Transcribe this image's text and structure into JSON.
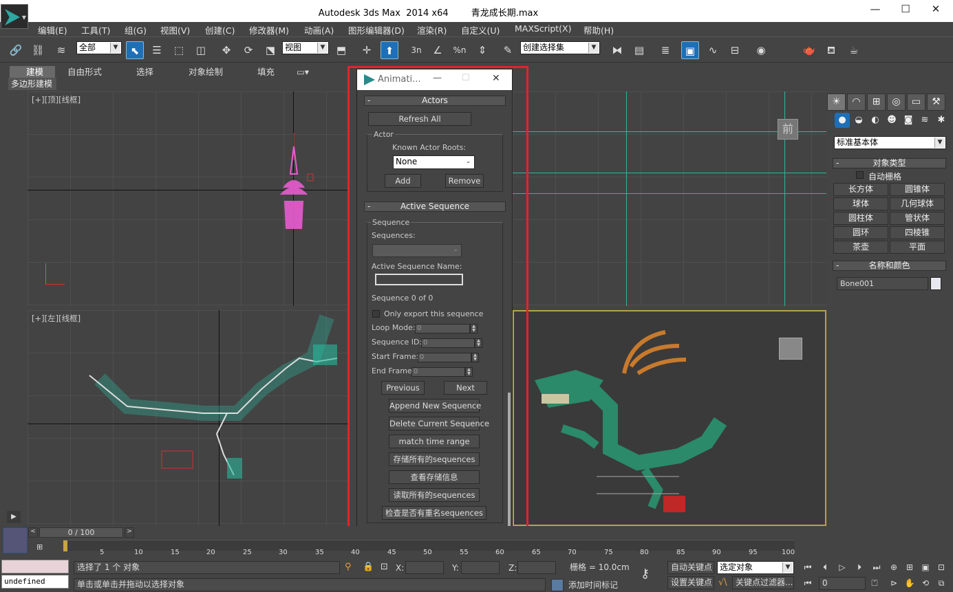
{
  "window": {
    "app_title": "Autodesk 3ds Max  2014 x64",
    "file_title": "青龙成长期.max",
    "minimize": "—",
    "maximize": "☐",
    "close": "✕"
  },
  "menu": [
    "编辑(E)",
    "工具(T)",
    "组(G)",
    "视图(V)",
    "创建(C)",
    "修改器(M)",
    "动画(A)",
    "图形编辑器(D)",
    "渲染(R)",
    "自定义(U)",
    "MAXScript(X)",
    "帮助(H)"
  ],
  "toolbar": {
    "selection_filter": "全部",
    "ref_coord": "视图",
    "named_selection": "创建选择集",
    "snap_label": "3n",
    "angle_snap": "%n"
  },
  "ribbon": {
    "tabs": [
      "建模",
      "自由形式",
      "选择",
      "对象绘制",
      "填充"
    ],
    "active_panel": "多边形建模"
  },
  "viewports": {
    "top_label": "[+][顶][线框]",
    "left_label": "[+][左][线框]",
    "persp_cube_label": "前"
  },
  "command_panel": {
    "tabs": [
      "☀",
      "◠",
      "⊞",
      "◎",
      "▭",
      "⚒"
    ],
    "subtabs": [
      "●",
      "◒",
      "◐",
      "☻",
      "◙",
      "≋",
      "✱"
    ],
    "category": "标准基本体",
    "object_type_title": "对象类型",
    "autogrid": "自动栅格",
    "buttons": [
      "长方体",
      "圆锥体",
      "球体",
      "几何球体",
      "圆柱体",
      "管状体",
      "圆环",
      "四棱锥",
      "茶壶",
      "平面"
    ],
    "name_color_title": "名称和颜色",
    "object_name": "Bone001",
    "object_color": "#e8e8f0"
  },
  "dialog": {
    "title": "Animati...",
    "actors_title": "Actors",
    "refresh_all": "Refresh All",
    "actor_group": "Actor",
    "known_roots_label": "Known Actor Roots:",
    "known_roots_value": "None",
    "add": "Add",
    "remove": "Remove",
    "active_seq_title": "Active Sequence",
    "sequence_group": "Sequence",
    "sequences_label": "Sequences:",
    "active_seq_name_label": "Active Sequence Name:",
    "seq_count": "Sequence 0 of 0",
    "only_export": "Only export this sequence",
    "loop_mode_label": "Loop Mode:",
    "loop_mode": "0",
    "seq_id_label": "Sequence ID:",
    "seq_id": "0",
    "start_frame_label": "Start Frame:",
    "start_frame": "0",
    "end_frame_label": "End Frame:",
    "end_frame": "0",
    "previous": "Previous",
    "next": "Next",
    "actions": [
      "Append New Sequence",
      "Delete Current Sequence",
      "match time range",
      "存储所有的sequences",
      "查看存储信息",
      "读取所有的sequences",
      "检查是否有重名sequences"
    ]
  },
  "timeline": {
    "frame_display": "0 / 100",
    "ticks": [
      "5",
      "10",
      "15",
      "20",
      "25",
      "30",
      "35",
      "40",
      "45",
      "50",
      "55",
      "60",
      "65",
      "70",
      "75",
      "80",
      "85",
      "90",
      "95",
      "100"
    ]
  },
  "status": {
    "maxscript_out": "undefined",
    "selection_msg": "选择了 1 个 对象",
    "prompt": "单击或单击并拖动以选择对象",
    "x_label": "X:",
    "y_label": "Y:",
    "z_label": "Z:",
    "grid": "栅格 = 10.0cm",
    "add_time_tag": "添加时间标记",
    "auto_key": "自动关键点",
    "set_key": "设置关键点",
    "key_mode": "选定对象",
    "key_filters": "关键点过滤器...",
    "current_frame": "0"
  },
  "colors": {
    "highlight": "#e0252b",
    "accent": "#1d6fb8",
    "wire": "#2ab89d",
    "selected": "#e85ccf"
  }
}
